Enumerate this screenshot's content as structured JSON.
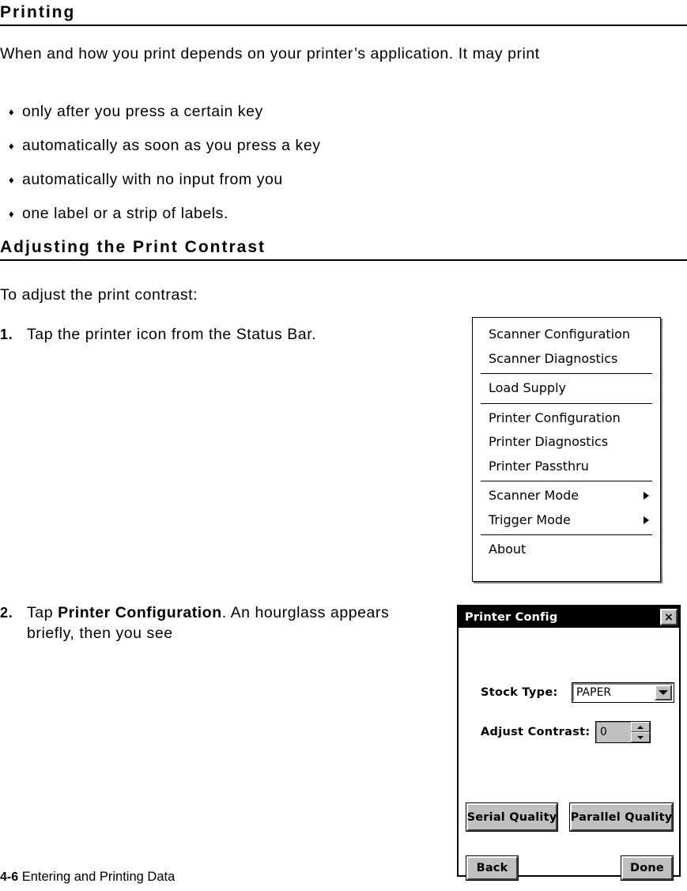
{
  "page": {
    "section_heading": "Printing",
    "intro_paragraph": "When and how you print depends on your printer’s application.  It may print",
    "bullet_marker": "♦",
    "bullets": [
      "only after you press a certain key",
      "automatically as soon as you press a key",
      "automatically with no input from you",
      "one label or a strip of labels."
    ],
    "subsection_heading": "Adjusting the Print Contrast",
    "lead_in": "To adjust the print contrast:",
    "steps": [
      {
        "number": "1.",
        "text_before": "Tap the printer icon from the Status Bar.",
        "bold": "",
        "text_after": ""
      },
      {
        "number": "2.",
        "text_before": "Tap ",
        "bold": "Printer Configuration",
        "text_after": ".  An hourglass appears briefly, then you see"
      }
    ],
    "footer": {
      "page_number": "4-6",
      "chapter_title": "Entering and Printing Data"
    }
  },
  "popup_menu": {
    "name": "printer-status-menu",
    "groups": [
      {
        "items": [
          {
            "label": "Scanner Configuration",
            "has_submenu": false
          },
          {
            "label": "Scanner Diagnostics",
            "has_submenu": false
          }
        ]
      },
      {
        "items": [
          {
            "label": "Load Supply",
            "has_submenu": false
          }
        ]
      },
      {
        "items": [
          {
            "label": "Printer Configuration",
            "has_submenu": false
          },
          {
            "label": "Printer Diagnostics",
            "has_submenu": false
          },
          {
            "label": "Printer Passthru",
            "has_submenu": false
          }
        ]
      },
      {
        "items": [
          {
            "label": "Scanner Mode",
            "has_submenu": true
          },
          {
            "label": "Trigger Mode",
            "has_submenu": true
          }
        ]
      },
      {
        "items": [
          {
            "label": "About",
            "has_submenu": false
          }
        ]
      }
    ]
  },
  "dialog": {
    "title": "Printer Config",
    "close_icon": "×",
    "fields": {
      "stock_type": {
        "label": "Stock Type:",
        "value": "PAPER",
        "dropdown_icon": "chevron-down-icon"
      },
      "adjust_contrast": {
        "label": "Adjust Contrast:",
        "value": "0",
        "up_icon": "spinner-up-icon",
        "down_icon": "spinner-down-icon"
      }
    },
    "buttons": {
      "serial_quality": "Serial Quality",
      "parallel_quality": "Parallel Quality",
      "back": "Back",
      "done": "Done"
    }
  },
  "colors": {
    "background": "#ffffff",
    "text": "#000000",
    "titlebar": "#000000",
    "control_face": "#c0c0c0",
    "control_shadow": "#404040",
    "control_highlight": "#ffffff"
  }
}
